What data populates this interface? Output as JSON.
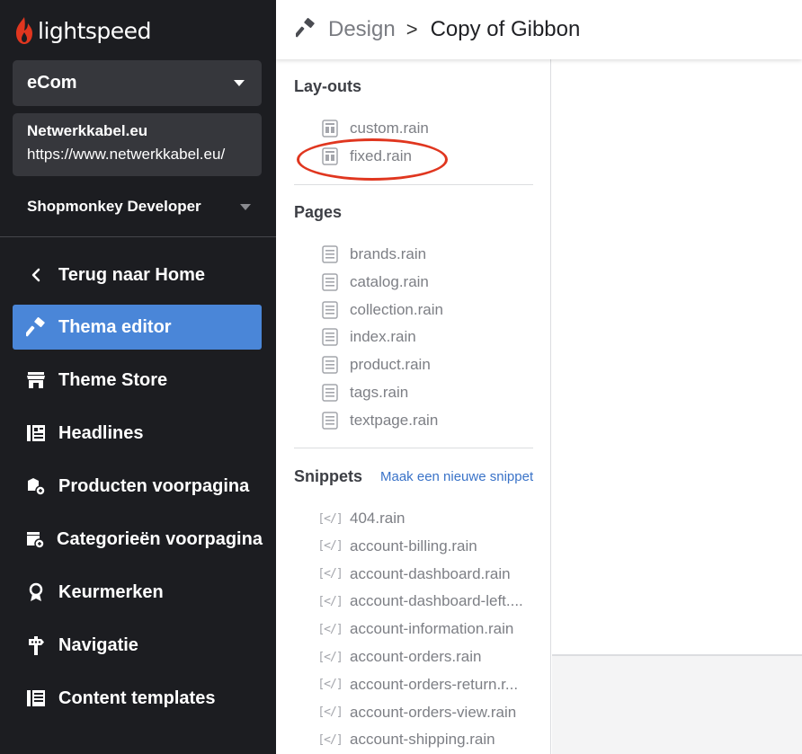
{
  "brand": {
    "name": "lightspeed",
    "accent": "#e0361f"
  },
  "sidebar": {
    "store_type": "eCom",
    "shop_name": "Netwerkkabel.eu",
    "shop_url": "https://www.netwerkkabel.eu/",
    "account": "Shopmonkey Developer",
    "active_color": "#4a86d8",
    "items": [
      {
        "label": "Terug naar Home",
        "icon": "chevron-left-icon"
      },
      {
        "label": "Thema editor",
        "icon": "hammer-icon",
        "active": true
      },
      {
        "label": "Theme Store",
        "icon": "store-icon"
      },
      {
        "label": "Headlines",
        "icon": "newspaper-icon"
      },
      {
        "label": "Producten voorpagina",
        "icon": "product-home-icon"
      },
      {
        "label": "Categorieën voorpagina",
        "icon": "category-home-icon"
      },
      {
        "label": "Keurmerken",
        "icon": "badge-icon"
      },
      {
        "label": "Navigatie",
        "icon": "signpost-icon"
      },
      {
        "label": "Content templates",
        "icon": "template-icon"
      }
    ]
  },
  "header": {
    "breadcrumb_parent": "Design",
    "breadcrumb_separator": ">",
    "breadcrumb_current": "Copy of Gibbon"
  },
  "files": {
    "layouts_title": "Lay-outs",
    "layouts": [
      "custom.rain",
      "fixed.rain"
    ],
    "pages_title": "Pages",
    "pages": [
      "brands.rain",
      "catalog.rain",
      "collection.rain",
      "index.rain",
      "product.rain",
      "tags.rain",
      "textpage.rain"
    ],
    "snippets_title": "Snippets",
    "new_snippet_link": "Maak een nieuwe snippet",
    "snippets": [
      "404.rain",
      "account-billing.rain",
      "account-dashboard.rain",
      "account-dashboard-left....",
      "account-information.rain",
      "account-orders.rain",
      "account-orders-return.r...",
      "account-orders-view.rain",
      "account-shipping.rain"
    ]
  }
}
